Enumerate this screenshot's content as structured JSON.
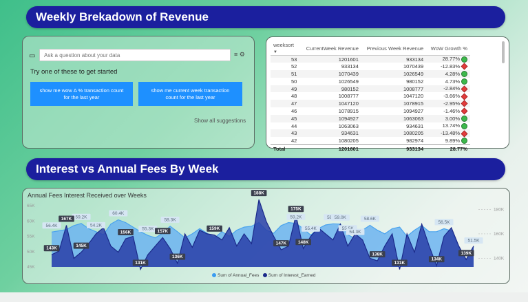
{
  "banners": {
    "revenue": "Weekly Brekadown of Revenue",
    "interest": "Interest vs Annual Fees By Week"
  },
  "qa": {
    "placeholder": "Ask a question about your data",
    "hint": "Try one of these to get started",
    "suggestions": [
      "show me wow Δ % transaction count for the last year",
      "show me current week transaction count for the last year"
    ],
    "show_all": "Show all suggestions"
  },
  "table": {
    "headers": [
      "weeksort",
      "CurrentWeek Revenue",
      "Previous Week Revenue",
      "WoW Growth %"
    ],
    "rows": [
      {
        "week": "53",
        "current": "1201601",
        "previous": "933134",
        "growth": "28.77%",
        "status": "up"
      },
      {
        "week": "52",
        "current": "933134",
        "previous": "1070439",
        "growth": "-12.83%",
        "status": "down"
      },
      {
        "week": "51",
        "current": "1070439",
        "previous": "1026549",
        "growth": "4.28%",
        "status": "up"
      },
      {
        "week": "50",
        "current": "1026549",
        "previous": "980152",
        "growth": "4.73%",
        "status": "up"
      },
      {
        "week": "49",
        "current": "980152",
        "previous": "1008777",
        "growth": "-2.84%",
        "status": "down"
      },
      {
        "week": "48",
        "current": "1008777",
        "previous": "1047120",
        "growth": "-3.66%",
        "status": "down"
      },
      {
        "week": "47",
        "current": "1047120",
        "previous": "1078915",
        "growth": "-2.95%",
        "status": "down"
      },
      {
        "week": "46",
        "current": "1078915",
        "previous": "1094927",
        "growth": "-1.46%",
        "status": "down"
      },
      {
        "week": "45",
        "current": "1094927",
        "previous": "1063063",
        "growth": "3.00%",
        "status": "up"
      },
      {
        "week": "44",
        "current": "1063063",
        "previous": "934631",
        "growth": "13.74%",
        "status": "up"
      },
      {
        "week": "43",
        "current": "934631",
        "previous": "1080205",
        "growth": "-13.48%",
        "status": "down"
      },
      {
        "week": "42",
        "current": "1080205",
        "previous": "982974",
        "growth": "9.89%",
        "status": "up"
      }
    ],
    "total": {
      "label": "Total",
      "current": "1201601",
      "previous": "933134",
      "growth": "28.77%"
    }
  },
  "chart_data": {
    "type": "area",
    "title": "Annual Fees Interest Received over Weeks",
    "left_axis": {
      "ticks": [
        "65K",
        "60K",
        "55K",
        "50K",
        "45K"
      ],
      "range": [
        45000,
        65000
      ]
    },
    "right_axis": {
      "ticks": [
        "180K",
        "160K",
        "140K"
      ],
      "range": [
        133000,
        183000
      ]
    },
    "series": [
      {
        "name": "Sum of Annual_Fees",
        "axis": "left",
        "color": "#6cb4f0",
        "values": [
          56400,
          56800,
          57200,
          58500,
          59200,
          57500,
          56500,
          55500,
          59000,
          60400,
          59500,
          58000,
          56500,
          55300,
          54500,
          56000,
          58300,
          56500,
          54500,
          55800,
          57500,
          56000,
          54500,
          56500,
          55000,
          57000,
          58000,
          58300,
          59500,
          57000,
          56000,
          58500,
          59500,
          59200,
          57500,
          55400,
          57500,
          58700,
          59100,
          59000,
          55500,
          54300,
          57000,
          58600,
          57000,
          55800,
          57500,
          58000,
          55000,
          57000,
          58500,
          56500,
          56500,
          57500,
          56800,
          51500,
          47500,
          51500
        ],
        "labels": [
          {
            "i": 0,
            "text": "56.4K"
          },
          {
            "i": 4,
            "text": "59.2K"
          },
          {
            "i": 6,
            "text": "54.2K"
          },
          {
            "i": 9,
            "text": "60.4K"
          },
          {
            "i": 13,
            "text": "55.3K"
          },
          {
            "i": 16,
            "text": "58.3K"
          },
          {
            "i": 33,
            "text": "59.2K"
          },
          {
            "i": 35,
            "text": "55.4K"
          },
          {
            "i": 38,
            "text": "59.1K"
          },
          {
            "i": 39,
            "text": "59.0K"
          },
          {
            "i": 40,
            "text": "55.5K"
          },
          {
            "i": 41,
            "text": "54.3K"
          },
          {
            "i": 43,
            "text": "58.6K"
          },
          {
            "i": 53,
            "text": "56.5K"
          },
          {
            "i": 57,
            "text": "51.5K"
          }
        ]
      },
      {
        "name": "Sum of Interest_Earned",
        "axis": "right",
        "color": "#2a3fa8",
        "values": [
          143000,
          146000,
          167000,
          140000,
          145000,
          152000,
          160000,
          165000,
          150000,
          145000,
          156000,
          158000,
          131000,
          143000,
          150000,
          157000,
          148000,
          136000,
          160000,
          149000,
          163000,
          160000,
          159000,
          155000,
          165000,
          150000,
          160000,
          152000,
          188000,
          170000,
          158000,
          147000,
          150000,
          175000,
          148000,
          158000,
          165000,
          160000,
          155000,
          168000,
          150000,
          160000,
          155000,
          140000,
          138000,
          150000,
          160000,
          131000,
          160000,
          145000,
          168000,
          150000,
          134000,
          158000,
          165000,
          150000,
          139000,
          150000
        ],
        "labels": [
          {
            "i": 0,
            "text": "143K"
          },
          {
            "i": 2,
            "text": "167K"
          },
          {
            "i": 4,
            "text": "145K"
          },
          {
            "i": 10,
            "text": "156K"
          },
          {
            "i": 12,
            "text": "131K"
          },
          {
            "i": 15,
            "text": "157K"
          },
          {
            "i": 17,
            "text": "136K"
          },
          {
            "i": 22,
            "text": "159K"
          },
          {
            "i": 28,
            "text": "188K"
          },
          {
            "i": 31,
            "text": "147K"
          },
          {
            "i": 33,
            "text": "175K"
          },
          {
            "i": 34,
            "text": "148K"
          },
          {
            "i": 44,
            "text": "138K"
          },
          {
            "i": 47,
            "text": "131K"
          },
          {
            "i": 52,
            "text": "134K"
          },
          {
            "i": 56,
            "text": "139K"
          }
        ]
      }
    ]
  }
}
